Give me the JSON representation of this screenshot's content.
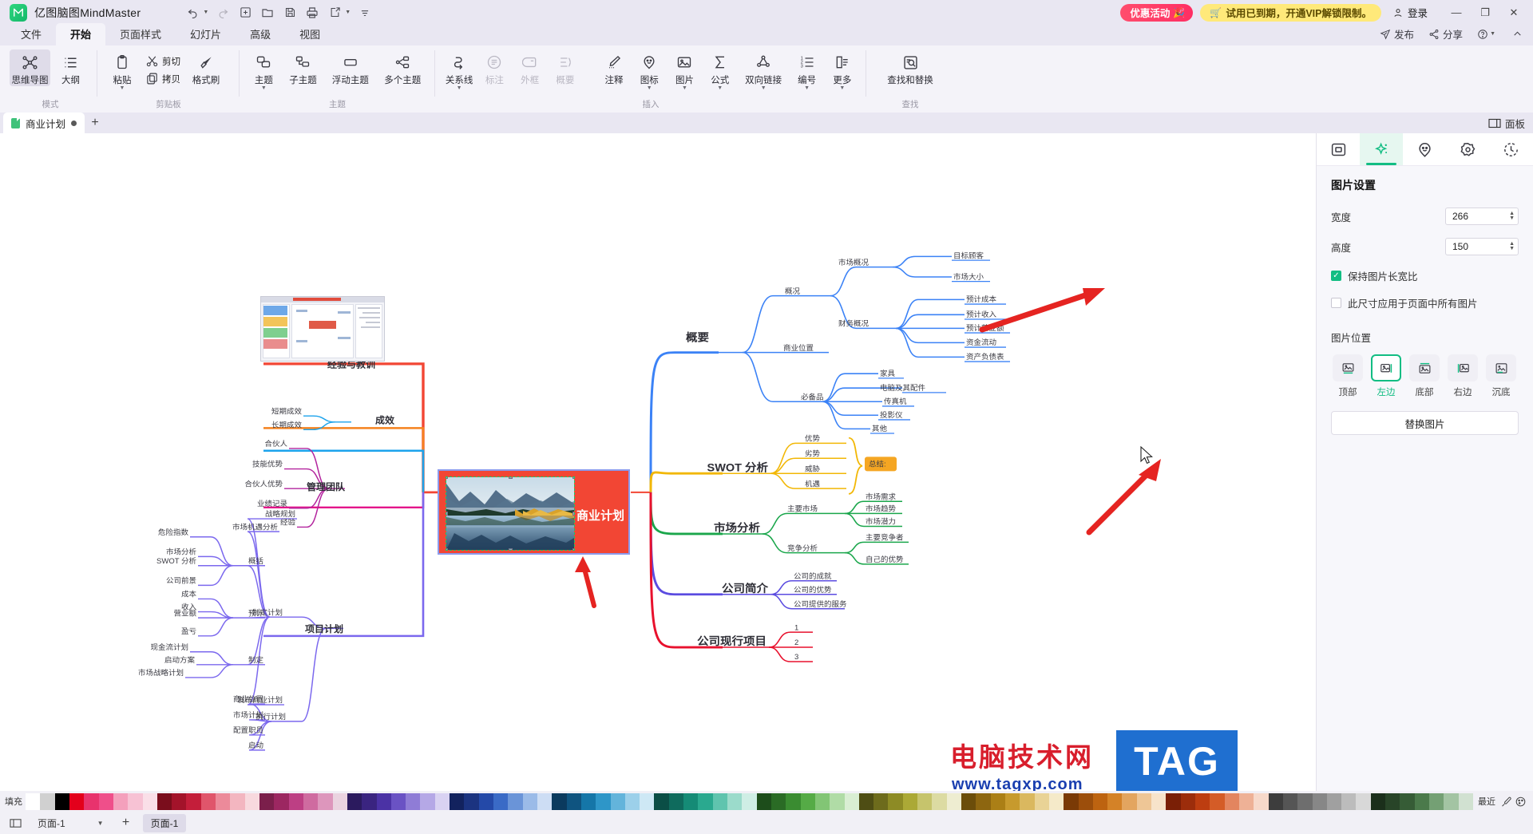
{
  "titlebar": {
    "app_name": "亿图脑图MindMaster",
    "logo_glyph": "M",
    "quick_actions": [
      {
        "name": "undo-button",
        "glyph": "↶",
        "dropdown": true
      },
      {
        "name": "redo-button",
        "glyph": "↷",
        "dropdown": false
      },
      {
        "name": "new-button",
        "glyph": "⊞",
        "dropdown": false
      },
      {
        "name": "open-button",
        "glyph": "🗁",
        "dropdown": false
      },
      {
        "name": "save-button",
        "glyph": "🖫",
        "dropdown": false
      },
      {
        "name": "print-button",
        "glyph": "🖶",
        "dropdown": false
      },
      {
        "name": "export-button",
        "glyph": "🖅",
        "dropdown": true
      },
      {
        "name": "more-qat-button",
        "glyph": "⩵",
        "dropdown": false
      }
    ],
    "promo_label": "优惠活动",
    "trial_label": "试用已到期，开通VIP解锁限制。",
    "login_label": "登录",
    "minimize": "—",
    "maximize": "❐",
    "close": "✕"
  },
  "menubar": {
    "tabs": [
      {
        "label": "文件",
        "active": false
      },
      {
        "label": "开始",
        "active": true
      },
      {
        "label": "页面样式",
        "active": false
      },
      {
        "label": "幻灯片",
        "active": false
      },
      {
        "label": "高级",
        "active": false
      },
      {
        "label": "视图",
        "active": false
      }
    ],
    "right_items": [
      {
        "label": "发布",
        "icon": "publish-icon"
      },
      {
        "label": "分享",
        "icon": "share-icon"
      },
      {
        "label": "",
        "icon": "help-icon"
      },
      {
        "label": "",
        "icon": "collapse-ribbon-icon"
      }
    ]
  },
  "ribbon": {
    "groups": [
      {
        "name": "mode",
        "label": "模式",
        "items": [
          {
            "label": "思维导图",
            "icon": "mindmap-icon",
            "selected": true,
            "dropdown": false,
            "disabled": false
          },
          {
            "label": "大纲",
            "icon": "outline-icon",
            "selected": false,
            "dropdown": false,
            "disabled": false
          }
        ]
      },
      {
        "name": "clipboard",
        "label": "剪贴板",
        "items": [
          {
            "label": "粘贴",
            "icon": "paste-icon",
            "dropdown": true,
            "disabled": false
          },
          {
            "label": "剪切",
            "icon": "cut-icon",
            "dropdown": false,
            "disabled": false
          },
          {
            "label": "拷贝",
            "icon": "copy-icon",
            "dropdown": false,
            "disabled": false
          },
          {
            "label": "格式刷",
            "icon": "format-painter-icon",
            "dropdown": false,
            "disabled": false
          }
        ]
      },
      {
        "name": "topic",
        "label": "主题",
        "items": [
          {
            "label": "主题",
            "icon": "topic-icon",
            "dropdown": true,
            "disabled": false
          },
          {
            "label": "子主题",
            "icon": "subtopic-icon",
            "dropdown": false,
            "disabled": false
          },
          {
            "label": "浮动主题",
            "icon": "floating-topic-icon",
            "dropdown": false,
            "disabled": false
          },
          {
            "label": "多个主题",
            "icon": "multi-topic-icon",
            "dropdown": false,
            "disabled": false
          }
        ]
      },
      {
        "name": "insert",
        "label": "插入",
        "items": [
          {
            "label": "关系线",
            "icon": "relationship-line-icon",
            "dropdown": true,
            "disabled": false
          },
          {
            "label": "标注",
            "icon": "callout-icon",
            "dropdown": false,
            "disabled": true
          },
          {
            "label": "外框",
            "icon": "boundary-icon",
            "dropdown": false,
            "disabled": true
          },
          {
            "label": "概要",
            "icon": "summary-icon",
            "dropdown": false,
            "disabled": true
          },
          {
            "label": "注释",
            "icon": "note-icon",
            "dropdown": false,
            "disabled": false
          },
          {
            "label": "图标",
            "icon": "sticker-icon",
            "dropdown": true,
            "disabled": false
          },
          {
            "label": "图片",
            "icon": "image-icon",
            "dropdown": true,
            "disabled": false
          },
          {
            "label": "公式",
            "icon": "formula-icon",
            "dropdown": true,
            "disabled": false
          },
          {
            "label": "双向链接",
            "icon": "bidirectional-link-icon",
            "dropdown": true,
            "disabled": false
          },
          {
            "label": "编号",
            "icon": "numbering-icon",
            "dropdown": true,
            "disabled": false
          },
          {
            "label": "更多",
            "icon": "more-icon",
            "dropdown": true,
            "disabled": false
          }
        ]
      },
      {
        "name": "find",
        "label": "查找",
        "items": [
          {
            "label": "查找和替换",
            "icon": "find-replace-icon",
            "dropdown": false,
            "disabled": false
          }
        ]
      }
    ]
  },
  "doc_tabs": {
    "tabs": [
      {
        "label": "商业计划",
        "modified": true
      }
    ],
    "add_label": "+",
    "panel_toggle_label": "面板"
  },
  "right_panel": {
    "tabs": [
      {
        "name": "style-tab",
        "icon": "style-panel-icon",
        "active": false
      },
      {
        "name": "image-tab",
        "icon": "sparkle-icon",
        "active": true
      },
      {
        "name": "sticker-tab",
        "icon": "smiley-icon",
        "active": false
      },
      {
        "name": "settings-tab",
        "icon": "gear-icon",
        "active": false
      },
      {
        "name": "history-tab",
        "icon": "clock-icon",
        "active": false
      }
    ],
    "title": "图片设置",
    "width_label": "宽度",
    "width_value": "266",
    "height_label": "高度",
    "height_value": "150",
    "keep_ratio_label": "保持图片长宽比",
    "keep_ratio_checked": true,
    "apply_all_label": "此尺寸应用于页面中所有图片",
    "apply_all_checked": false,
    "position_title": "图片位置",
    "positions": [
      {
        "label": "顶部",
        "name": "position-top",
        "active": false
      },
      {
        "label": "左边",
        "name": "position-left",
        "active": true
      },
      {
        "label": "底部",
        "name": "position-bottom",
        "active": false
      },
      {
        "label": "右边",
        "name": "position-right",
        "active": false
      },
      {
        "label": "沉底",
        "name": "position-behind",
        "active": false
      }
    ],
    "replace_label": "替换图片"
  },
  "palette": {
    "fill_label": "填充",
    "recent_label": "最近",
    "colors": [
      "#ffffff",
      "#d0d0d0",
      "#000000",
      "#e3001b",
      "#e8336d",
      "#ef4f8a",
      "#f4a0bc",
      "#f7c2d4",
      "#fadfe8",
      "#7a0d1c",
      "#a3132a",
      "#c41e3a",
      "#e0556b",
      "#ec8a9a",
      "#f3b6c0",
      "#f8d9de",
      "#7b1f4b",
      "#9c2761",
      "#bd3f84",
      "#cf6ba0",
      "#dd96bc",
      "#ead3e0",
      "#2b1a5e",
      "#3a2480",
      "#4b32a5",
      "#6a52c4",
      "#8f7cd6",
      "#b5a8e6",
      "#d9d2f2",
      "#12225e",
      "#1b3380",
      "#2449a8",
      "#3a6ac6",
      "#6a94d8",
      "#9bbbe8",
      "#cdddf4",
      "#0b3a5e",
      "#0f5480",
      "#1576a8",
      "#2e96c8",
      "#63b4db",
      "#9cd0ea",
      "#cee8f5",
      "#0b4e46",
      "#0f6b5d",
      "#158b76",
      "#2aa98f",
      "#5fc4ae",
      "#9bdbcb",
      "#cfeee5",
      "#1d4d1b",
      "#2a6b25",
      "#3a8c31",
      "#55ab46",
      "#82c575",
      "#b0dca6",
      "#d9eed3",
      "#4e4d14",
      "#6d6b1c",
      "#8d8b25",
      "#aba936",
      "#c6c46c",
      "#dcdba2",
      "#eeedd1",
      "#6b4d0a",
      "#8d6610",
      "#ab7f16",
      "#c79a2d",
      "#dab85f",
      "#e9d396",
      "#f5eac9",
      "#7a3a06",
      "#9c4e0b",
      "#bd6310",
      "#d48227",
      "#e3a55f",
      "#eec696",
      "#f7e3ca",
      "#7a1f06",
      "#9c2d0b",
      "#bd3d10",
      "#d45c27",
      "#e3855f",
      "#eeb196",
      "#f7d9ca",
      "#3d3d3d",
      "#555555",
      "#6e6e6e",
      "#878787",
      "#a0a0a0",
      "#bcbcbc",
      "#d8d8d8",
      "#1b2f1b",
      "#284428",
      "#365c36",
      "#4b7a4b",
      "#74a074",
      "#a3c4a3",
      "#d1e1d1"
    ]
  },
  "statusbar": {
    "page_label": "页面-1",
    "page_chip": "页面-1",
    "add_page": "+"
  },
  "mindmap": {
    "central": "商业计划",
    "left_branches": [
      {
        "label": "经验与教训",
        "color": "#f5821f"
      },
      {
        "label": "成效",
        "color": "#1ca3ec",
        "children": [
          {
            "label": "短期成效"
          },
          {
            "label": "长期成效"
          }
        ]
      },
      {
        "label": "管理团队",
        "color": "#e3168a",
        "children": [
          {
            "label": "合伙人"
          },
          {
            "label": "技能优势"
          },
          {
            "label": "合伙人优势"
          },
          {
            "label": "业绩记录"
          },
          {
            "label": "经验"
          }
        ]
      },
      {
        "label": "项目计划",
        "color": "#7b68ee"
      }
    ],
    "project_plan": {
      "sub": [
        {
          "label": "制定计划",
          "children": [
            {
              "label": "战略规划"
            },
            {
              "label": "市场机遇分析"
            },
            {
              "label": "概括",
              "children": [
                "危险指数",
                "市场分析",
                "SWOT 分析",
                "公司前景"
              ]
            },
            {
              "label": "预计",
              "children": [
                "成本",
                "收入",
                "营业额",
                "盈亏"
              ]
            },
            {
              "label": "制定",
              "children": [
                "现金流计划",
                "启动方案",
                "市场战略计划"
              ]
            },
            {
              "label": "发布商业计划"
            }
          ]
        },
        {
          "label": "执行计划",
          "children": [
            "商业位置",
            "市场计划",
            "配置职员",
            "启动"
          ]
        }
      ]
    },
    "right_branches": [
      {
        "label": "概要",
        "color": "#3b82f6",
        "children": [
          {
            "label": "概况",
            "children": [
              {
                "label": "市场概况",
                "children": [
                  "目标顾客",
                  "市场大小"
                ]
              },
              {
                "label": "财务概况",
                "children": [
                  "预计成本",
                  "预计收入",
                  "预计营业额",
                  "资金流动",
                  "资产负债表"
                ]
              }
            ]
          },
          {
            "label": "商业位置"
          },
          {
            "label": "必备品",
            "children": [
              "家具",
              "电脑及其配件",
              "传真机",
              "投影仪",
              "其他"
            ]
          }
        ]
      },
      {
        "label": "SWOT 分析",
        "color": "#f2b705",
        "children": [
          "优势",
          "劣势",
          "威胁",
          "机遇"
        ],
        "summary": "总结:"
      },
      {
        "label": "市场分析",
        "color": "#1aa64b",
        "children": [
          {
            "label": "主要市场",
            "children": [
              "市场需求",
              "市场趋势",
              "市场潜力"
            ]
          },
          {
            "label": "竞争分析",
            "children": [
              "主要竞争者",
              "自己的优势"
            ]
          }
        ]
      },
      {
        "label": "公司简介",
        "color": "#5b4ce0",
        "children": [
          "公司的成就",
          "公司的优势",
          "公司提供的服务"
        ]
      },
      {
        "label": "公司现行项目",
        "color": "#e8112d",
        "children": [
          "1",
          "2",
          "3"
        ]
      }
    ]
  },
  "watermark": {
    "site_cn": "电脑技术网",
    "site_url": "www.tagxp.com",
    "tag": "TAG"
  }
}
